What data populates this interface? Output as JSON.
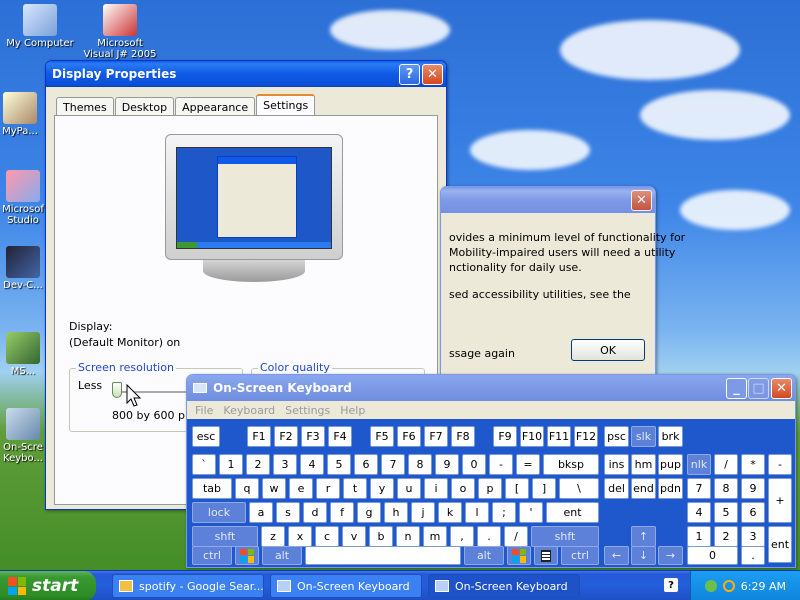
{
  "desktop": {
    "icons": [
      {
        "label": "My Computer"
      },
      {
        "label": "Microsoft Visual J# 2005 Exp..."
      },
      {
        "label": "MyPa..."
      },
      {
        "label": "Microsof Studio"
      },
      {
        "label": "Dev-C..."
      },
      {
        "label": "MS..."
      },
      {
        "label": "On-Scre Keybo..."
      }
    ]
  },
  "display_properties": {
    "title": "Display Properties",
    "tabs": [
      "Themes",
      "Desktop",
      "Appearance",
      "Settings"
    ],
    "active_tab": "Settings",
    "display_label": "Display:",
    "display_value": "(Default Monitor) on",
    "screen_resolution": {
      "title": "Screen resolution",
      "less": "Less",
      "value": "800 by 600 pixe..."
    },
    "color_quality": {
      "title": "Color quality"
    }
  },
  "dialog": {
    "lines": [
      "ovides a minimum level of functionality for",
      "Mobility-impaired users will need a utility",
      "nctionality for daily use.",
      "sed accessibility utilities, see the",
      "ssage again"
    ],
    "ok_label": "OK"
  },
  "osk": {
    "title": "On-Screen Keyboard",
    "menu": [
      "File",
      "Keyboard",
      "Settings",
      "Help"
    ]
  },
  "taskbar": {
    "start_label": "start",
    "tasks": [
      {
        "label": "spotify - Google Sear..."
      },
      {
        "label": "On-Screen Keyboard"
      },
      {
        "label": "On-Screen Keyboard"
      }
    ],
    "clock": "6:29 AM"
  },
  "colors": {
    "titlebar": "#0f5ae6",
    "keyboard_bg": "#1f58cc",
    "start": "#3a9a32",
    "window_face": "#ece9d8"
  }
}
